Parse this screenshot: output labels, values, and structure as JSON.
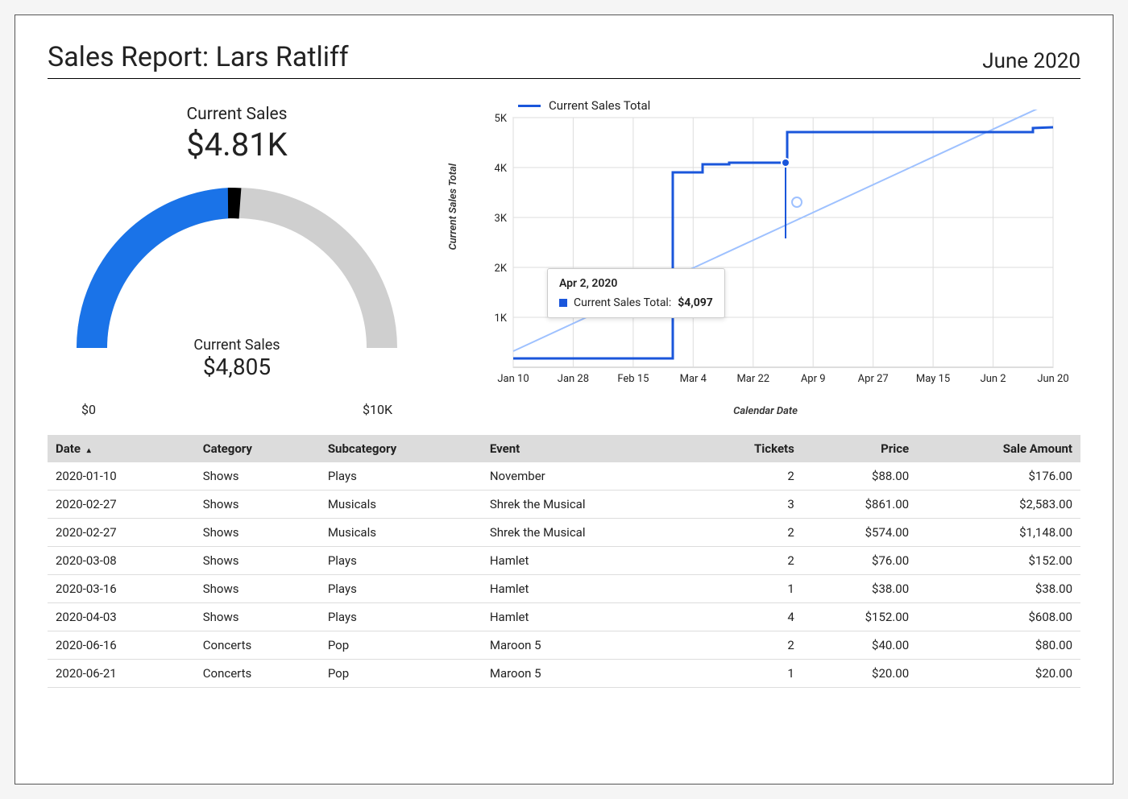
{
  "header": {
    "title": "Sales Report: Lars Ratliff",
    "period": "June 2020"
  },
  "gauge": {
    "top_label": "Current Sales",
    "top_value": "$4.81K",
    "mid_label": "Current Sales",
    "mid_value": "$4,805",
    "min_label": "$0",
    "max_label": "$10K"
  },
  "line_chart": {
    "legend_label": "Current Sales Total",
    "y_title": "Current Sales Total",
    "x_title": "Calendar Date",
    "y_ticks": [
      "1K",
      "2K",
      "3K",
      "4K",
      "5K"
    ],
    "x_ticks": [
      "Jan 10",
      "Jan 28",
      "Feb 15",
      "Mar 4",
      "Mar 22",
      "Apr 9",
      "Apr 27",
      "May 15",
      "Jun 2",
      "Jun 20"
    ]
  },
  "tooltip": {
    "date": "Apr 2, 2020",
    "series": "Current Sales Total:",
    "value": "$4,097"
  },
  "table": {
    "cols": [
      {
        "label": "Date",
        "sortIcon": "▴"
      },
      {
        "label": "Category"
      },
      {
        "label": "Subcategory"
      },
      {
        "label": "Event"
      },
      {
        "label": "Tickets",
        "num": true
      },
      {
        "label": "Price",
        "num": true
      },
      {
        "label": "Sale Amount",
        "num": true
      }
    ],
    "rows": [
      [
        "2020-01-10",
        "Shows",
        "Plays",
        "November",
        "2",
        "$88.00",
        "$176.00"
      ],
      [
        "2020-02-27",
        "Shows",
        "Musicals",
        "Shrek the Musical",
        "3",
        "$861.00",
        "$2,583.00"
      ],
      [
        "2020-02-27",
        "Shows",
        "Musicals",
        "Shrek the Musical",
        "2",
        "$574.00",
        "$1,148.00"
      ],
      [
        "2020-03-08",
        "Shows",
        "Plays",
        "Hamlet",
        "2",
        "$76.00",
        "$152.00"
      ],
      [
        "2020-03-16",
        "Shows",
        "Plays",
        "Hamlet",
        "1",
        "$38.00",
        "$38.00"
      ],
      [
        "2020-04-03",
        "Shows",
        "Plays",
        "Hamlet",
        "4",
        "$152.00",
        "$608.00"
      ],
      [
        "2020-06-16",
        "Concerts",
        "Pop",
        "Maroon 5",
        "2",
        "$40.00",
        "$80.00"
      ],
      [
        "2020-06-21",
        "Concerts",
        "Pop",
        "Maroon 5",
        "1",
        "$20.00",
        "$20.00"
      ]
    ]
  },
  "chart_data": [
    {
      "type": "gauge",
      "title": "Current Sales",
      "value": 4805,
      "display_value": "$4.81K",
      "min": 0,
      "max": 10000,
      "unit": "$"
    },
    {
      "type": "line",
      "title": "Current Sales Total",
      "xlabel": "Calendar Date",
      "ylabel": "Current Sales Total",
      "ylim": [
        0,
        5000
      ],
      "x": [
        "2020-01-10",
        "2020-02-27",
        "2020-03-08",
        "2020-03-16",
        "2020-04-03",
        "2020-06-16",
        "2020-06-21"
      ],
      "series": [
        {
          "name": "Current Sales Total",
          "values": [
            176,
            3907,
            4059,
            4097,
            4705,
            4785,
            4805
          ]
        }
      ],
      "highlight": {
        "x": "2020-04-02",
        "value": 4097
      },
      "trendline": true
    }
  ]
}
